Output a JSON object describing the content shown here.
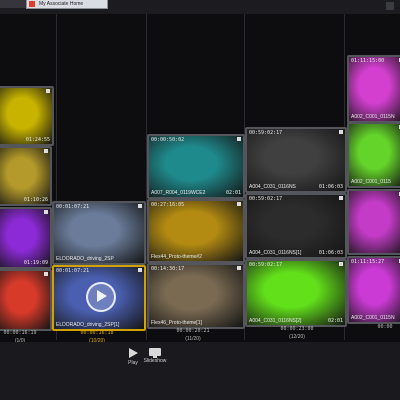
{
  "browser": {
    "prev_tab_label": "",
    "active_tab_label": "My Associate Home",
    "favicon_color": "#e03b2f"
  },
  "columns": [
    {
      "timecode": "00:00:16:19",
      "count": "(1/0)",
      "selected": false
    },
    {
      "timecode": "00:00:16:18",
      "count": "(10/20)",
      "selected": true
    },
    {
      "timecode": "00:00:20:21",
      "count": "(11/20)",
      "selected": false
    },
    {
      "timecode": "00:00:23:00",
      "count": "(12/20)",
      "selected": false
    },
    {
      "timecode": "00:00",
      "count": "",
      "selected": false
    }
  ],
  "clips": [
    {
      "id": "c1",
      "tc_start": "",
      "tc_end": "01:24:55",
      "name": "",
      "color": "#c8b400",
      "selected": false
    },
    {
      "id": "c2",
      "tc_start": "",
      "tc_end": "01:10:26",
      "name": "",
      "color": "#b39a2a",
      "selected": false
    },
    {
      "id": "c3",
      "tc_start": "",
      "tc_end": "01:19:09",
      "name": "",
      "color": "#8b2ad6",
      "selected": false
    },
    {
      "id": "c4",
      "tc_start": "",
      "tc_end": "",
      "name": "",
      "color": "#d83a2a",
      "selected": false
    },
    {
      "id": "c5",
      "tc_start": "00:01:07:21",
      "tc_end": "",
      "name": "ELDORADO_driving_2SP",
      "color": "#6a7c9a",
      "selected": false
    },
    {
      "id": "c6",
      "tc_start": "00:01:07:21",
      "tc_end": "",
      "name": "ELDORADO_driving_2SP[1]",
      "color": "#4a5fb0",
      "selected": true
    },
    {
      "id": "c7",
      "tc_start": "00:00:50:02",
      "tc_end": "02:01",
      "name": "A007_R004_0119WCE2",
      "color": "#1f8a8c",
      "selected": false
    },
    {
      "id": "c8",
      "tc_start": "00:27:16:05",
      "tc_end": "",
      "name": "Flex44_Proto-theme#2",
      "color": "#b38b12",
      "selected": false
    },
    {
      "id": "c9",
      "tc_start": "00:14:30:17",
      "tc_end": "",
      "name": "Flex46_Proto-theme[1]",
      "color": "#7a6a52",
      "selected": false
    },
    {
      "id": "c10",
      "tc_start": "00:59:02:17",
      "tc_end": "01:06:03",
      "name": "A004_C031_0116NS",
      "color": "#404040",
      "selected": false
    },
    {
      "id": "c11",
      "tc_start": "00:59:02:17",
      "tc_end": "01:06:03",
      "name": "A004_C031_0116NS[1]",
      "color": "#2c2c2c",
      "selected": false
    },
    {
      "id": "c12",
      "tc_start": "00:59:02:17",
      "tc_end": "02:01",
      "name": "A004_C031_0116NS[2]",
      "color": "#62e01a",
      "selected": false
    },
    {
      "id": "c13",
      "tc_start": "01:11:15:00",
      "tc_end": "",
      "name": "A002_C001_0115N",
      "color": "#d43fd0",
      "selected": false
    },
    {
      "id": "c14",
      "tc_start": "",
      "tc_end": "",
      "name": "A002_C001_0115",
      "color": "#64d42a",
      "selected": false
    },
    {
      "id": "c15",
      "tc_start": "",
      "tc_end": "",
      "name": "",
      "color": "#c43bc8",
      "selected": false
    },
    {
      "id": "c16",
      "tc_start": "01:11:15:27",
      "tc_end": "",
      "name": "A002_C001_0115N",
      "color": "#cc3ad6",
      "selected": false
    }
  ],
  "toolbar": {
    "play_label": "Play",
    "slideshow_label": "Slideshow"
  }
}
